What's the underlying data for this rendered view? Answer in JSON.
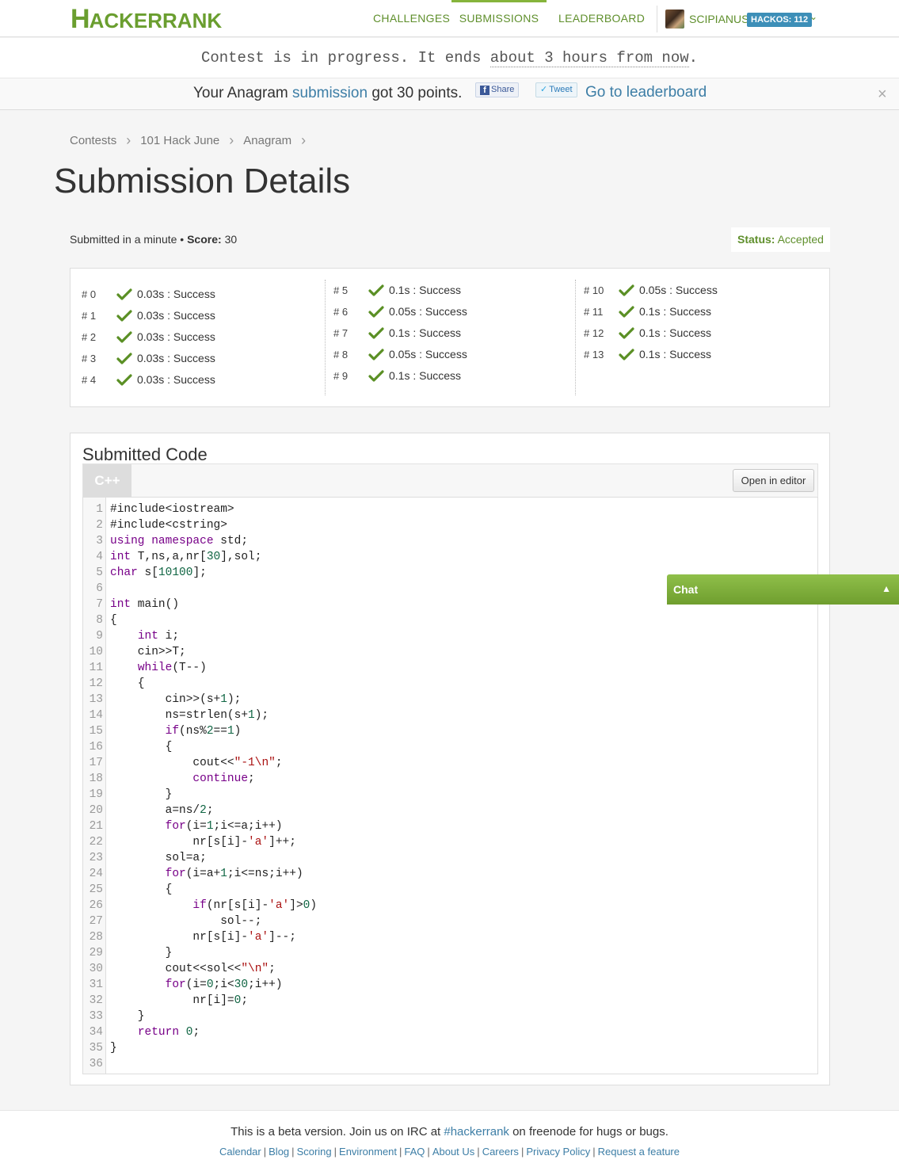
{
  "nav": {
    "logo_first": "H",
    "logo_rest": "ACKERRANK",
    "items": [
      {
        "label": "CHALLENGES",
        "active": false
      },
      {
        "label": "SUBMISSIONS",
        "active": true
      },
      {
        "label": "LEADERBOARD",
        "active": false
      }
    ],
    "username": "SCIPIANUS",
    "hackos": "HACKOS: 112"
  },
  "contest": {
    "prefix": "Contest is in progress. It ends ",
    "relative": "about 3 hours from now",
    "suffix": "."
  },
  "notification": {
    "prefix": "Your Anagram ",
    "link": "submission",
    "suffix": " got 30 points.",
    "share_label": "Share",
    "tweet_label": "Tweet",
    "leaderboard_link": "Go to leaderboard",
    "close": "×"
  },
  "breadcrumb": [
    "Contests",
    "101 Hack June",
    "Anagram"
  ],
  "page_title": "Submission Details",
  "submission": {
    "submitted_text": "Submitted in a minute",
    "bullet": " • ",
    "score_label": "Score:",
    "score_value": "30",
    "status_label": "Status:",
    "status_value": "Accepted"
  },
  "testcases": [
    [
      {
        "id": "# 0",
        "result": "0.03s : Success"
      },
      {
        "id": "# 1",
        "result": "0.03s : Success"
      },
      {
        "id": "# 2",
        "result": "0.03s : Success"
      },
      {
        "id": "# 3",
        "result": "0.03s : Success"
      },
      {
        "id": "# 4",
        "result": "0.03s : Success"
      }
    ],
    [
      {
        "id": "# 5",
        "result": "0.1s : Success"
      },
      {
        "id": "# 6",
        "result": "0.05s : Success"
      },
      {
        "id": "# 7",
        "result": "0.1s : Success"
      },
      {
        "id": "# 8",
        "result": "0.05s : Success"
      },
      {
        "id": "# 9",
        "result": "0.1s : Success"
      }
    ],
    [
      {
        "id": "# 10",
        "result": "0.05s : Success"
      },
      {
        "id": "# 11",
        "result": "0.1s : Success"
      },
      {
        "id": "# 12",
        "result": "0.1s : Success"
      },
      {
        "id": "# 13",
        "result": "0.1s : Success"
      }
    ]
  ],
  "code": {
    "title": "Submitted Code",
    "language": "C++",
    "open_editor": "Open in editor",
    "lines": [
      "#include<iostream>",
      "#include<cstring>",
      "using namespace std;",
      "int T,ns,a,nr[30],sol;",
      "char s[10100];",
      "",
      "int main()",
      "{",
      "    int i;",
      "    cin>>T;",
      "    while(T--)",
      "    {",
      "        cin>>(s+1);",
      "        ns=strlen(s+1);",
      "        if(ns%2==1)",
      "        {",
      "            cout<<\"-1\\n\";",
      "            continue;",
      "        }",
      "        a=ns/2;",
      "        for(i=1;i<=a;i++)",
      "            nr[s[i]-'a']++;",
      "        sol=a;",
      "        for(i=a+1;i<=ns;i++)",
      "        {",
      "            if(nr[s[i]-'a']>0)",
      "                sol--;",
      "            nr[s[i]-'a']--;",
      "        }",
      "        cout<<sol<<\"\\n\";",
      "        for(i=0;i<30;i++)",
      "            nr[i]=0;",
      "    }",
      "    return 0;",
      "}",
      ""
    ]
  },
  "chat": {
    "label": "Chat"
  },
  "footer": {
    "line_prefix": "This is a beta version. Join us on IRC at ",
    "irc_link": "#hackerrank",
    "line_suffix": " on freenode for hugs or bugs.",
    "links": [
      "Calendar",
      "Blog",
      "Scoring",
      "Environment",
      "FAQ",
      "About Us",
      "Careers",
      "Privacy Policy",
      "Request a feature"
    ]
  },
  "colors": {
    "brand_green": "#6a9e2f",
    "link_blue": "#3d7ea6",
    "hackos_blue": "#3d8fb8",
    "chat_green": "#7fae3a"
  }
}
